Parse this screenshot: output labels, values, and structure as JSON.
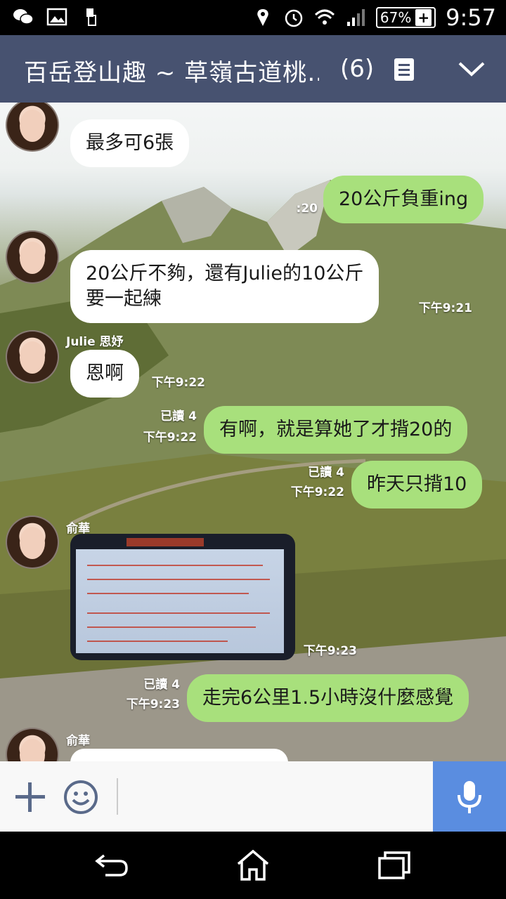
{
  "status_bar": {
    "battery": "67%",
    "time": "9:57"
  },
  "header": {
    "title": "百岳登山趣 ~ 草嶺古道桃…",
    "member_count": "(6)"
  },
  "messages": [
    {
      "side": "in",
      "text": "最多可6張"
    },
    {
      "side": "out",
      "text": "20公斤負重ing",
      "time": ":20"
    },
    {
      "side": "in",
      "text": "20公斤不夠，還有Julie的10公斤\n要一起練",
      "time": "下午9:21"
    },
    {
      "side": "in",
      "sender": "Julie 思妤",
      "text": "恩啊",
      "time": "下午9:22"
    },
    {
      "side": "out",
      "text": "有啊，就是算她了才揹20的",
      "read": "已讀 4",
      "time": "下午9:22"
    },
    {
      "side": "out",
      "text": "昨天只揹10",
      "read": "已讀 4",
      "time": "下午9:22"
    },
    {
      "side": "in",
      "sender": "俞華",
      "type": "image",
      "time": "下午9:23"
    },
    {
      "side": "out",
      "text": "走完6公里1.5小時沒什麼感覺",
      "read": "已讀 4",
      "time": "下午9:23"
    },
    {
      "side": "in",
      "sender": "俞華"
    }
  ],
  "composer": {
    "placeholder": ""
  },
  "colors": {
    "header_bg": "#475270",
    "outgoing_bubble": "#a8e07c",
    "incoming_bubble": "#ffffff",
    "mic_button": "#5a8de0"
  },
  "icons": {
    "status_left": [
      "wechat-icon",
      "gallery-icon",
      "phone-sync-icon"
    ],
    "status_right": [
      "location-icon",
      "alarm-icon",
      "wifi-icon",
      "signal-icon",
      "battery-icon"
    ],
    "header": [
      "note-icon",
      "chevron-down-icon"
    ],
    "composer": [
      "plus-icon",
      "emoji-icon",
      "microphone-icon"
    ],
    "nav": [
      "back-icon",
      "home-icon",
      "recents-icon"
    ]
  }
}
